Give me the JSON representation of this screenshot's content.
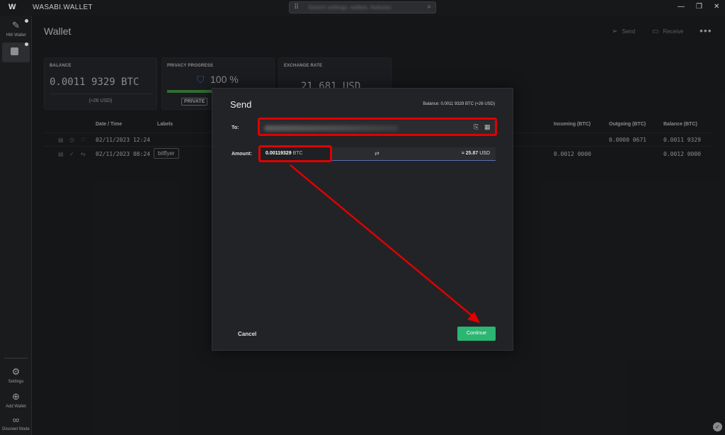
{
  "titlebar": {
    "app_name": "WASABI.WALLET",
    "search_placeholder": "Search settings, wallets, features",
    "min": "—",
    "max": "❐",
    "close": "✕"
  },
  "sidebar": {
    "hw_wallet": "HW Wallet",
    "settings": "Settings",
    "add_wallet": "Add Wallet",
    "discreet_mode": "Discreet Mode"
  },
  "header": {
    "title": "Wallet",
    "send": "Send",
    "receive": "Receive",
    "more": "•••"
  },
  "tiles": {
    "balance": {
      "title": "BALANCE",
      "btc": "0.0011 9329 BTC",
      "usd": "(≈26 USD)"
    },
    "privacy": {
      "title": "PRIVACY PROGRESS",
      "value": "100 %",
      "progress": 1.0,
      "badge": "PRIVATE"
    },
    "rate": {
      "title": "EXCHANGE RATE",
      "value": "21 681 USD"
    }
  },
  "table": {
    "headers": {
      "date": "Date / Time",
      "labels": "Labels",
      "incoming": "Incoming (BTC)",
      "outgoing": "Outgoing (BTC)",
      "balance": "Balance (BTC)"
    },
    "rows": [
      {
        "date": "02/11/2023 12:24",
        "label": "",
        "incoming": "",
        "outgoing": "0.0000 0671",
        "balance": "0.0011 9329"
      },
      {
        "date": "02/11/2023 08:24",
        "label": "bitflyer",
        "incoming": "0.0012 0000",
        "outgoing": "",
        "balance": "0.0012 0000"
      }
    ]
  },
  "dialog": {
    "title": "Send",
    "balance": "Balance: 0.0011 9329 BTC (≈26 USD)",
    "to_label": "To:",
    "amount_label": "Amount:",
    "amount_btc": "0.00119329",
    "amount_unit": "BTC",
    "amount_usd": "≈ 25.87",
    "usd_unit": "USD",
    "cancel": "Cancel",
    "continue": "Continue"
  },
  "colors": {
    "accent_green": "#2bb673",
    "highlight_red": "#e00000",
    "shield_blue": "#3c78c8"
  }
}
